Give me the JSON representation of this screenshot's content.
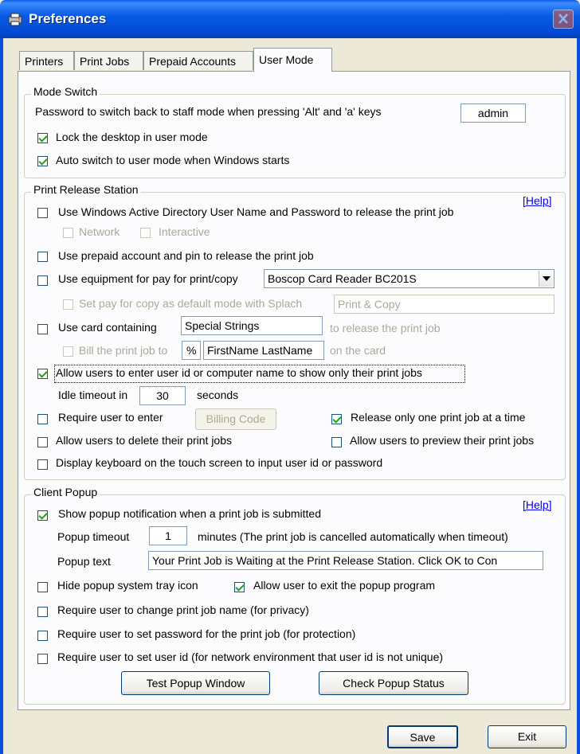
{
  "window": {
    "title": "Preferences"
  },
  "tabs": [
    "Printers",
    "Print Jobs",
    "Prepaid Accounts",
    "User Mode"
  ],
  "mode_switch": {
    "label": "Mode Switch",
    "password_label": "Password to switch back to staff mode when pressing 'Alt' and 'a' keys",
    "password_value": "admin",
    "lock_desktop": "Lock the desktop in user mode",
    "auto_switch": "Auto switch to user mode when Windows starts"
  },
  "print_release": {
    "label": "Print Release Station",
    "help": "[Help]",
    "use_ad": "Use Windows Active Directory User Name and Password to release the print job",
    "network": "Network",
    "interactive": "Interactive",
    "use_prepaid": "Use prepaid account and pin to release the print job",
    "use_equipment": "Use equipment for pay for print/copy",
    "equipment_value": "Boscop Card Reader BC201S",
    "set_pay_copy": "Set pay for copy as default mode with Splach",
    "pay_copy_value": "Print & Copy",
    "use_card": "Use card containing",
    "card_value": "Special Strings",
    "card_suffix": "to release the print job",
    "bill_to": "Bill the print job to",
    "bill_prefix": "%",
    "bill_value": "FirstName LastName",
    "bill_suffix": "on the card",
    "allow_userid": "Allow users to enter user id or computer name to show only their print jobs",
    "idle_label": "Idle timeout in",
    "idle_value": "30",
    "idle_unit": "seconds",
    "require_enter": "Require user to enter",
    "billing_code": "Billing Code",
    "release_one": "Release only one print job at a time",
    "allow_delete": "Allow users to delete their print jobs",
    "allow_preview": "Allow users to preview their print jobs",
    "display_keyboard": "Display keyboard on the touch screen to input user id or password"
  },
  "client_popup": {
    "label": "Client Popup",
    "help": "[Help]",
    "show_popup": "Show popup notification when a print job is submitted",
    "timeout_label": "Popup timeout",
    "timeout_value": "1",
    "timeout_suffix": "minutes (The print job is cancelled automatically when timeout)",
    "text_label": "Popup text",
    "text_value": "Your Print Job is Waiting at the Print Release Station. Click OK to Con",
    "hide_tray": "Hide popup system tray icon",
    "allow_exit": "Allow user to exit the popup program",
    "change_name": "Require user to change print job name (for privacy)",
    "set_password": "Require user to set password for the print job (for protection)",
    "set_userid": "Require user to set user id  (for network environment that user id is not unique)",
    "test_button": "Test Popup Window",
    "check_button": "Check Popup Status"
  },
  "footer": {
    "save": "Save",
    "exit": "Exit"
  }
}
